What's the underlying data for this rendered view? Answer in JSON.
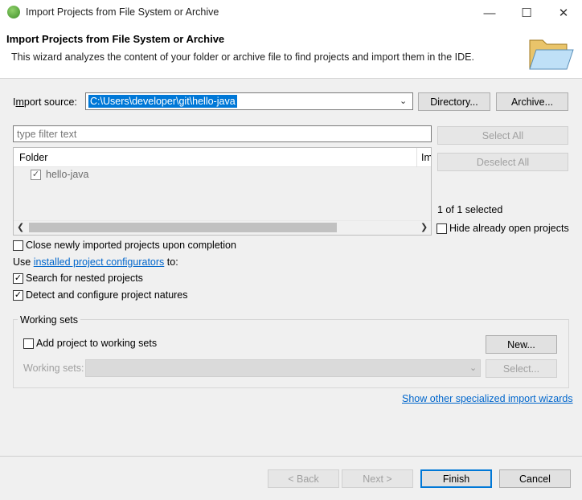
{
  "window": {
    "title": "Import Projects from File System or Archive",
    "minimize_glyph": "—",
    "maximize_glyph": "☐",
    "close_glyph": "✕"
  },
  "header": {
    "title": "Import Projects from File System or Archive",
    "description": "This wizard analyzes the content of your folder or archive file to find projects and import them in the IDE."
  },
  "import_source": {
    "label": "Import source:",
    "value": "C:\\Users\\developer\\git\\hello-java",
    "directory_button": "Directory...",
    "archive_button": "Archive..."
  },
  "filter": {
    "placeholder": "type filter text"
  },
  "tree": {
    "columns": [
      "Folder",
      "Im"
    ],
    "rows": [
      {
        "label": "hello-java",
        "checked": true
      }
    ]
  },
  "selection": {
    "select_all": "Select All",
    "deselect_all": "Deselect All",
    "count_text": "1 of 1 selected",
    "hide_open_label": "Hide already open projects",
    "hide_open_checked": false
  },
  "options": {
    "close_imported_label": "Close newly imported projects upon completion",
    "close_imported_checked": false,
    "use_prefix": "Use ",
    "configurators_link": "installed project configurators",
    "use_suffix": " to:",
    "search_nested_label": "Search for nested projects",
    "search_nested_checked": true,
    "detect_natures_label": "Detect and configure project natures",
    "detect_natures_checked": true
  },
  "working_sets": {
    "group_label": "Working sets",
    "add_label": "Add project to working sets",
    "add_checked": false,
    "sets_label": "Working sets:",
    "new_button": "New...",
    "select_button": "Select..."
  },
  "specialized_link": "Show other specialized import wizards",
  "footer": {
    "back": "< Back",
    "next": "Next >",
    "finish": "Finish",
    "cancel": "Cancel"
  },
  "colors": {
    "accent": "#0078d7",
    "link": "#0066cc",
    "disabled": "#a0a0a0"
  }
}
